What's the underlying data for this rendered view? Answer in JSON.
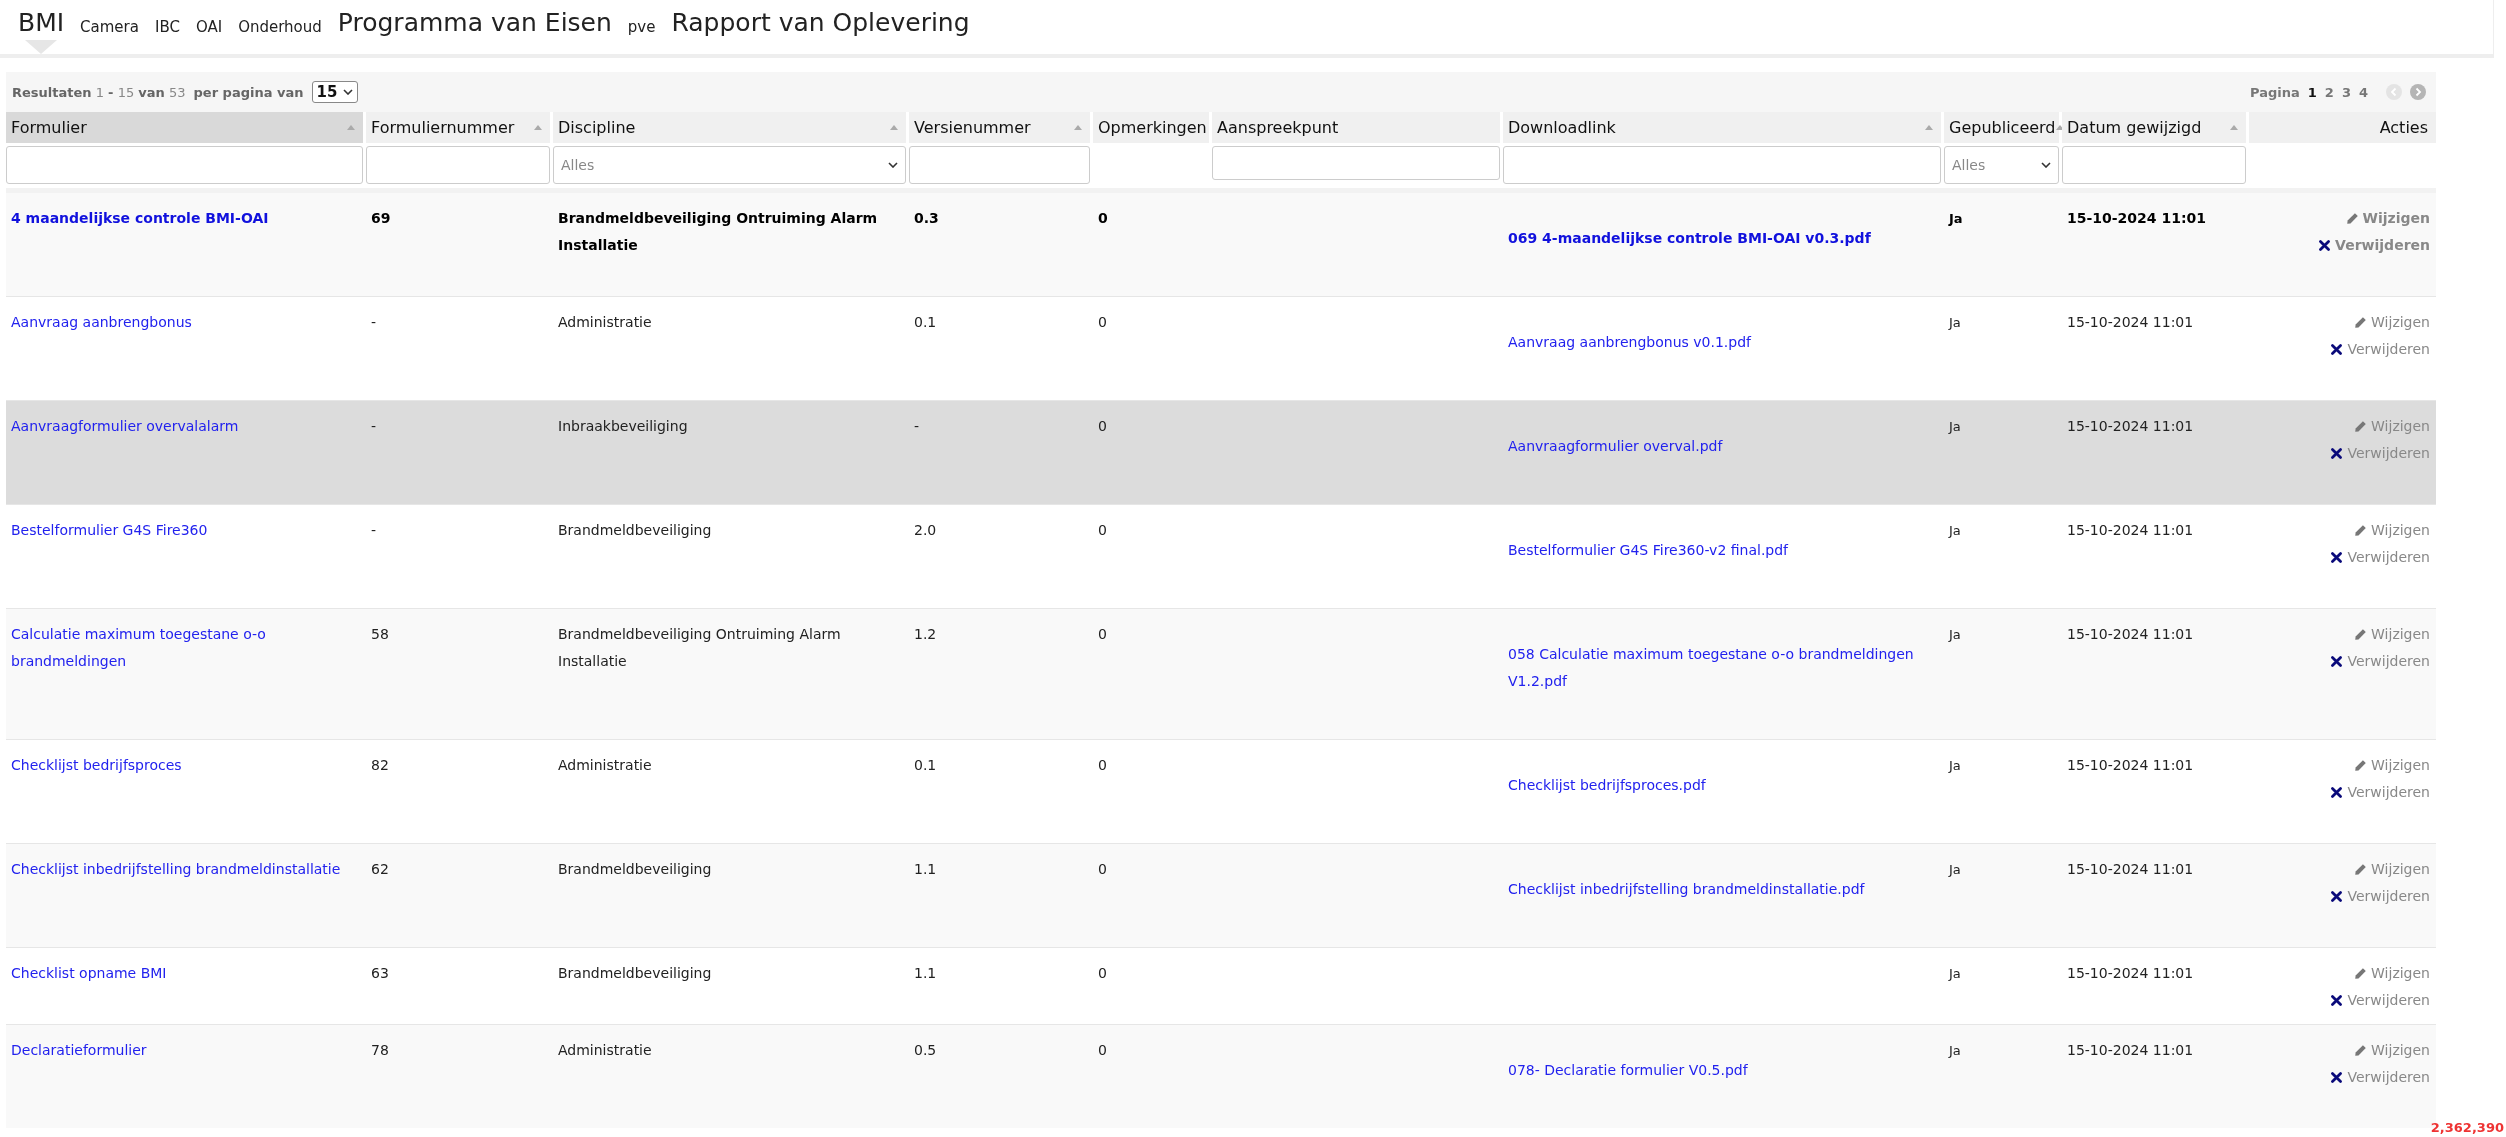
{
  "nav": [
    {
      "label": "BMI",
      "kind": "large",
      "selected": true
    },
    {
      "label": "Camera",
      "kind": "small",
      "selected": false
    },
    {
      "label": "IBC",
      "kind": "small",
      "selected": false
    },
    {
      "label": "OAI",
      "kind": "small",
      "selected": false
    },
    {
      "label": "Onderhoud",
      "kind": "small",
      "selected": false
    },
    {
      "label": "Programma van Eisen",
      "kind": "large",
      "selected": false
    },
    {
      "label": "pve",
      "kind": "small",
      "selected": false
    },
    {
      "label": "Rapport van Oplevering",
      "kind": "large",
      "selected": false
    }
  ],
  "toolbar": {
    "results": "**Resultaten** 1 **-** 15 **van** 53",
    "per_page_label": "per pagina van",
    "per_page_value": "15",
    "pagination": {
      "label": "Pagina",
      "pages": [
        {
          "label": "1",
          "selected": true
        },
        {
          "label": "2",
          "selected": false
        },
        {
          "label": "3",
          "selected": false
        },
        {
          "label": "4",
          "selected": false
        }
      ]
    }
  },
  "table": {
    "columns": [
      {
        "label": "Formulier",
        "sortable": true,
        "sorted": true,
        "kind": "text"
      },
      {
        "label": "Formuliernummer",
        "sortable": true,
        "sorted": false,
        "kind": "text"
      },
      {
        "label": "Discipline",
        "sortable": true,
        "sorted": false,
        "kind": "select",
        "placeholder": "Alles"
      },
      {
        "label": "Versienummer",
        "sortable": true,
        "sorted": false,
        "kind": "text"
      },
      {
        "label": "Opmerkingen",
        "sortable": false,
        "sorted": false,
        "kind": "none"
      },
      {
        "label": "Aanspreekpunt",
        "sortable": false,
        "sorted": false,
        "kind": "text"
      },
      {
        "label": "Downloadlink",
        "sortable": true,
        "sorted": false,
        "kind": "text"
      },
      {
        "label": "Gepubliceerd",
        "sortable": true,
        "sorted": false,
        "kind": "select",
        "placeholder": "Alles"
      },
      {
        "label": "Datum gewijzigd",
        "sortable": true,
        "sorted": false,
        "kind": "text"
      },
      {
        "label": "Acties",
        "sortable": false,
        "sorted": false,
        "kind": "none"
      }
    ],
    "rows": [
      {
        "emphasized": true,
        "selected": false,
        "formulier": "4 maandelijkse controle BMI-OAI",
        "nummer": "69",
        "discipline": "Brandmeldbeveiliging Ontruiming Alarm Installatie",
        "versie": "0.3",
        "opmerkingen": "0",
        "download": "069 4-maandelijkse controle BMI-OAI v0.3.pdf",
        "gepubliceerd": "Ja",
        "datum": "15-10-2024 11:01",
        "edit": "Wijzigen",
        "delete": "Verwijderen"
      },
      {
        "emphasized": false,
        "selected": false,
        "formulier": "Aanvraag aanbrengbonus",
        "nummer": "-",
        "discipline": "Administratie",
        "versie": "0.1",
        "opmerkingen": "0",
        "download": "Aanvraag aanbrengbonus v0.1.pdf",
        "gepubliceerd": "Ja",
        "datum": "15-10-2024 11:01",
        "edit": "Wijzigen",
        "delete": "Verwijderen"
      },
      {
        "emphasized": false,
        "selected": true,
        "formulier": "Aanvraagformulier overvalalarm",
        "nummer": "-",
        "discipline": "Inbraakbeveiliging",
        "versie": "-",
        "opmerkingen": "0",
        "download": "Aanvraagformulier overval.pdf",
        "gepubliceerd": "Ja",
        "datum": "15-10-2024 11:01",
        "edit": "Wijzigen",
        "delete": "Verwijderen"
      },
      {
        "emphasized": false,
        "selected": false,
        "formulier": "Bestelformulier G4S Fire360",
        "nummer": "-",
        "discipline": "Brandmeldbeveiliging",
        "versie": "2.0",
        "opmerkingen": "0",
        "download": "Bestelformulier G4S Fire360-v2 final.pdf",
        "gepubliceerd": "Ja",
        "datum": "15-10-2024 11:01",
        "edit": "Wijzigen",
        "delete": "Verwijderen"
      },
      {
        "emphasized": false,
        "selected": false,
        "formulier": "Calculatie maximum toegestane o-o brandmeldingen",
        "nummer": "58",
        "discipline": "Brandmeldbeveiliging Ontruiming Alarm Installatie",
        "versie": "1.2",
        "opmerkingen": "0",
        "download": "058 Calculatie maximum toegestane o-o brandmeldingen V1.2.pdf",
        "gepubliceerd": "Ja",
        "datum": "15-10-2024 11:01",
        "edit": "Wijzigen",
        "delete": "Verwijderen"
      },
      {
        "emphasized": false,
        "selected": false,
        "formulier": "Checklijst bedrijfsproces",
        "nummer": "82",
        "discipline": "Administratie",
        "versie": "0.1",
        "opmerkingen": "0",
        "download": "Checklijst bedrijfsproces.pdf",
        "gepubliceerd": "Ja",
        "datum": "15-10-2024 11:01",
        "edit": "Wijzigen",
        "delete": "Verwijderen"
      },
      {
        "emphasized": false,
        "selected": false,
        "formulier": "Checklijst inbedrijfstelling brandmeldinstallatie",
        "nummer": "62",
        "discipline": "Brandmeldbeveiliging",
        "versie": "1.1",
        "opmerkingen": "0",
        "download": "Checklijst inbedrijfstelling brandmeldinstallatie.pdf",
        "gepubliceerd": "Ja",
        "datum": "15-10-2024 11:01",
        "edit": "Wijzigen",
        "delete": "Verwijderen"
      },
      {
        "emphasized": false,
        "selected": false,
        "formulier": "Checklist opname BMI",
        "nummer": "63",
        "discipline": "Brandmeldbeveiliging",
        "versie": "1.1",
        "opmerkingen": "0",
        "gepubliceerd": "Ja",
        "datum": "15-10-2024 11:01",
        "edit": "Wijzigen",
        "delete": "Verwijderen"
      },
      {
        "emphasized": false,
        "selected": false,
        "formulier": "Declaratieformulier",
        "nummer": "78",
        "discipline": "Administratie",
        "versie": "0.5",
        "opmerkingen": "0",
        "download": "078- Declaratie formulier V0.5.pdf",
        "gepubliceerd": "Ja",
        "datum": "15-10-2024 11:01",
        "edit": "Wijzigen",
        "delete": "Verwijderen"
      }
    ]
  },
  "readout": "2,362,390"
}
